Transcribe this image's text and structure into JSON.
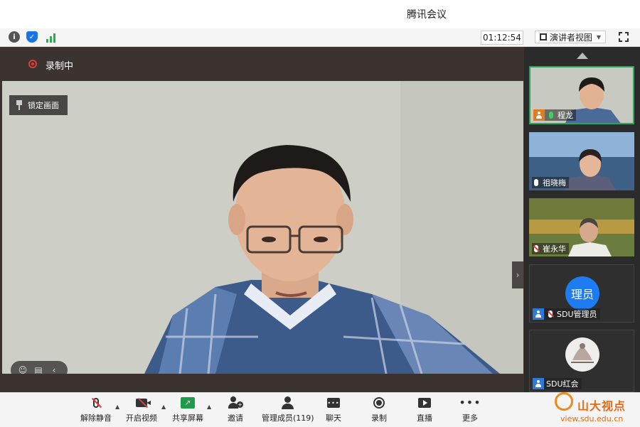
{
  "window": {
    "title": "腾讯会议"
  },
  "infobar": {
    "timer": "01:12:54",
    "view_mode": "演讲者视图"
  },
  "stage": {
    "recording_label": "录制中",
    "lock_label": "锁定画面"
  },
  "participants": [
    {
      "name": "程龙",
      "role": "host",
      "mic": "on"
    },
    {
      "name": "祖晓梅",
      "role": "participant",
      "mic": "on"
    },
    {
      "name": "崔永华",
      "role": "participant",
      "mic": "muted"
    },
    {
      "name": "SDU管理员",
      "role": "user",
      "mic": "muted",
      "avatar_text": "理员",
      "avatar_color": "#1e7cf2"
    },
    {
      "name": "SDU红会",
      "role": "user",
      "mic": "muted"
    }
  ],
  "toolbar": {
    "unmute": "解除静音",
    "start_video": "开启视频",
    "share_screen": "共享屏幕",
    "invite": "邀请",
    "manage_members": "管理成员(119)",
    "chat": "聊天",
    "record": "录制",
    "live": "直播",
    "more": "更多"
  },
  "watermark": {
    "text": "山大视点",
    "url": "view.sdu.edu.cn"
  },
  "colors": {
    "accent_green": "#2ea55c",
    "record_red": "#e03b3b",
    "host_orange": "#e07c1e",
    "user_blue": "#2b7bd6"
  }
}
